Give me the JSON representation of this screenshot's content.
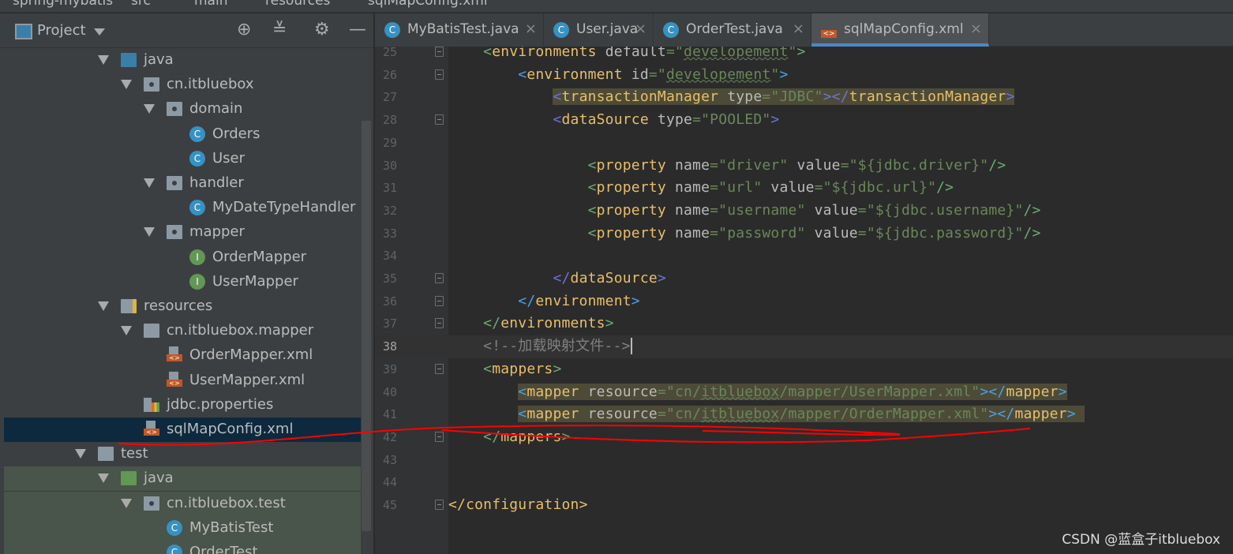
{
  "breadcrumb": [
    "spring-mybatis",
    "src",
    "main",
    "resources",
    "sqlMapConfig.xml"
  ],
  "project_panel": {
    "title": "Project",
    "icons": [
      "locate-icon",
      "collapse-all-icon",
      "gear-icon",
      "minimize-icon"
    ]
  },
  "tree": [
    {
      "label": "java",
      "level": 3,
      "icon": "folder-blue",
      "arrow": true
    },
    {
      "label": "cn.itbluebox",
      "level": 4,
      "icon": "package",
      "arrow": true
    },
    {
      "label": "domain",
      "level": 5,
      "icon": "package",
      "arrow": true
    },
    {
      "label": "Orders",
      "level": 6,
      "icon": "class"
    },
    {
      "label": "User",
      "level": 6,
      "icon": "class"
    },
    {
      "label": "handler",
      "level": 5,
      "icon": "package",
      "arrow": true
    },
    {
      "label": "MyDateTypeHandler",
      "level": 6,
      "icon": "class"
    },
    {
      "label": "mapper",
      "level": 5,
      "icon": "package",
      "arrow": true
    },
    {
      "label": "OrderMapper",
      "level": 6,
      "icon": "interface"
    },
    {
      "label": "UserMapper",
      "level": 6,
      "icon": "interface"
    },
    {
      "label": "resources",
      "level": 3,
      "icon": "resources",
      "arrow": true
    },
    {
      "label": "cn.itbluebox.mapper",
      "level": 4,
      "icon": "folder",
      "arrow": true
    },
    {
      "label": "OrderMapper.xml",
      "level": 5,
      "icon": "xml"
    },
    {
      "label": "UserMapper.xml",
      "level": 5,
      "icon": "xml"
    },
    {
      "label": "jdbc.properties",
      "level": 4,
      "icon": "properties"
    },
    {
      "label": "sqlMapConfig.xml",
      "level": 4,
      "icon": "xml",
      "selected": true
    },
    {
      "label": "test",
      "level": 2,
      "icon": "folder",
      "arrow": true
    },
    {
      "label": "java",
      "level": 3,
      "icon": "folder-green",
      "arrow": true,
      "test": true
    },
    {
      "label": "cn.itbluebox.test",
      "level": 4,
      "icon": "package",
      "arrow": true,
      "test": true
    },
    {
      "label": "MyBatisTest",
      "level": 5,
      "icon": "class",
      "test": true
    },
    {
      "label": "OrderTest",
      "level": 5,
      "icon": "class",
      "test": true
    }
  ],
  "tabs": [
    {
      "label": "MyBatisTest.java",
      "icon": "class"
    },
    {
      "label": "User.java",
      "icon": "class"
    },
    {
      "label": "OrderTest.java",
      "icon": "class"
    },
    {
      "label": "sqlMapConfig.xml",
      "icon": "xml",
      "active": true
    }
  ],
  "code": [
    {
      "n": 25,
      "fold": true,
      "t": [
        [
          "p",
          "    "
        ],
        [
          "bg",
          "<"
        ],
        [
          "tag",
          "environments"
        ],
        [
          "p",
          " "
        ],
        [
          "attr",
          "default"
        ],
        [
          "val",
          "=\""
        ],
        [
          "valsq",
          "developement"
        ],
        [
          "val",
          "\""
        ],
        [
          "bg",
          ">"
        ]
      ]
    },
    {
      "n": 26,
      "fold": true,
      "t": [
        [
          "p",
          "        "
        ],
        [
          "bb",
          "<"
        ],
        [
          "tag",
          "environment"
        ],
        [
          "p",
          " "
        ],
        [
          "attr",
          "id"
        ],
        [
          "val",
          "=\""
        ],
        [
          "valsq",
          "developement"
        ],
        [
          "val",
          "\""
        ],
        [
          "bb",
          ">"
        ]
      ]
    },
    {
      "n": 27,
      "hl": true,
      "t": [
        [
          "p",
          "            "
        ],
        [
          "bp",
          "<"
        ],
        [
          "tag",
          "transactionManager"
        ],
        [
          "p",
          " "
        ],
        [
          "attr",
          "type"
        ],
        [
          "val",
          "=\"JDBC\""
        ],
        [
          "bp",
          "></"
        ],
        [
          "tag",
          "transactionManager"
        ],
        [
          "bp",
          ">"
        ]
      ]
    },
    {
      "n": 28,
      "fold": true,
      "t": [
        [
          "p",
          "            "
        ],
        [
          "bp",
          "<"
        ],
        [
          "tag",
          "dataSource"
        ],
        [
          "p",
          " "
        ],
        [
          "attr",
          "type"
        ],
        [
          "val",
          "=\"POOLED\""
        ],
        [
          "bp",
          ">"
        ]
      ]
    },
    {
      "n": 29,
      "t": []
    },
    {
      "n": 30,
      "t": [
        [
          "p",
          "                "
        ],
        [
          "bg",
          "<"
        ],
        [
          "tag",
          "property"
        ],
        [
          "p",
          " "
        ],
        [
          "attr",
          "name"
        ],
        [
          "val",
          "=\"driver\""
        ],
        [
          "p",
          " "
        ],
        [
          "attr",
          "value"
        ],
        [
          "val",
          "=\"${jdbc.driver}\""
        ],
        [
          "bg",
          "/>"
        ]
      ]
    },
    {
      "n": 31,
      "t": [
        [
          "p",
          "                "
        ],
        [
          "bg",
          "<"
        ],
        [
          "tag",
          "property"
        ],
        [
          "p",
          " "
        ],
        [
          "attr",
          "name"
        ],
        [
          "val",
          "=\"url\""
        ],
        [
          "p",
          " "
        ],
        [
          "attr",
          "value"
        ],
        [
          "val",
          "=\"${jdbc.url}\""
        ],
        [
          "bg",
          "/>"
        ]
      ]
    },
    {
      "n": 32,
      "t": [
        [
          "p",
          "                "
        ],
        [
          "bg",
          "<"
        ],
        [
          "tag",
          "property"
        ],
        [
          "p",
          " "
        ],
        [
          "attr",
          "name"
        ],
        [
          "val",
          "=\"username\""
        ],
        [
          "p",
          " "
        ],
        [
          "attr",
          "value"
        ],
        [
          "val",
          "=\"${jdbc.username}\""
        ],
        [
          "bg",
          "/>"
        ]
      ]
    },
    {
      "n": 33,
      "t": [
        [
          "p",
          "                "
        ],
        [
          "bg",
          "<"
        ],
        [
          "tag",
          "property"
        ],
        [
          "p",
          " "
        ],
        [
          "attr",
          "name"
        ],
        [
          "val",
          "=\"password\""
        ],
        [
          "p",
          " "
        ],
        [
          "attr",
          "value"
        ],
        [
          "val",
          "=\"${jdbc.password}\""
        ],
        [
          "bg",
          "/>"
        ]
      ]
    },
    {
      "n": 34,
      "t": []
    },
    {
      "n": 35,
      "fold": true,
      "t": [
        [
          "p",
          "            "
        ],
        [
          "bp",
          "</"
        ],
        [
          "tag",
          "dataSource"
        ],
        [
          "bp",
          ">"
        ]
      ]
    },
    {
      "n": 36,
      "fold": true,
      "t": [
        [
          "p",
          "        "
        ],
        [
          "bb",
          "</"
        ],
        [
          "tag",
          "environment"
        ],
        [
          "bb",
          ">"
        ]
      ]
    },
    {
      "n": 37,
      "fold": true,
      "t": [
        [
          "p",
          "    "
        ],
        [
          "bg",
          "</"
        ],
        [
          "tag",
          "environments"
        ],
        [
          "bg",
          ">"
        ]
      ]
    },
    {
      "n": 38,
      "cur": true,
      "t": [
        [
          "p",
          "    "
        ],
        [
          "com",
          "<!--加载映射文件-->"
        ],
        [
          "caret",
          ""
        ]
      ]
    },
    {
      "n": 39,
      "fold": true,
      "t": [
        [
          "p",
          "    "
        ],
        [
          "bg",
          "<"
        ],
        [
          "tag",
          "mappers"
        ],
        [
          "bg",
          ">"
        ]
      ]
    },
    {
      "n": 40,
      "hl": true,
      "t": [
        [
          "p",
          "        "
        ],
        [
          "bb",
          "<"
        ],
        [
          "tag",
          "mapper"
        ],
        [
          "p",
          " "
        ],
        [
          "attr",
          "resource"
        ],
        [
          "val",
          "=\"cn/"
        ],
        [
          "valsq",
          "itbluebox"
        ],
        [
          "val",
          "/mapper/UserMapper.xml\""
        ],
        [
          "bb",
          "></"
        ],
        [
          "tag",
          "mapper"
        ],
        [
          "bb",
          ">"
        ]
      ]
    },
    {
      "n": 41,
      "hl": true,
      "t": [
        [
          "p",
          "        "
        ],
        [
          "bb",
          "<"
        ],
        [
          "tag",
          "mapper"
        ],
        [
          "p",
          " "
        ],
        [
          "attr",
          "resource"
        ],
        [
          "val",
          "=\"cn/"
        ],
        [
          "valsq",
          "itbluebox"
        ],
        [
          "val",
          "/mapper/OrderMapper.xml\""
        ],
        [
          "bb",
          "></"
        ],
        [
          "tag",
          "mapper"
        ],
        [
          "bb",
          "> "
        ]
      ]
    },
    {
      "n": 42,
      "fold": true,
      "t": [
        [
          "p",
          "    "
        ],
        [
          "bg",
          "</"
        ],
        [
          "tag",
          "mappers"
        ],
        [
          "bg",
          ">"
        ]
      ]
    },
    {
      "n": 43,
      "t": []
    },
    {
      "n": 44,
      "t": []
    },
    {
      "n": 45,
      "fold": true,
      "t": [
        [
          "by",
          "</"
        ],
        [
          "tag",
          "configuration"
        ],
        [
          "by",
          ">"
        ]
      ]
    }
  ],
  "watermark": "CSDN @蓝盒子itbluebox",
  "colors": {
    "annotation": "#ff0000",
    "accent": "#4a88c7",
    "selection": "#0d293e"
  }
}
